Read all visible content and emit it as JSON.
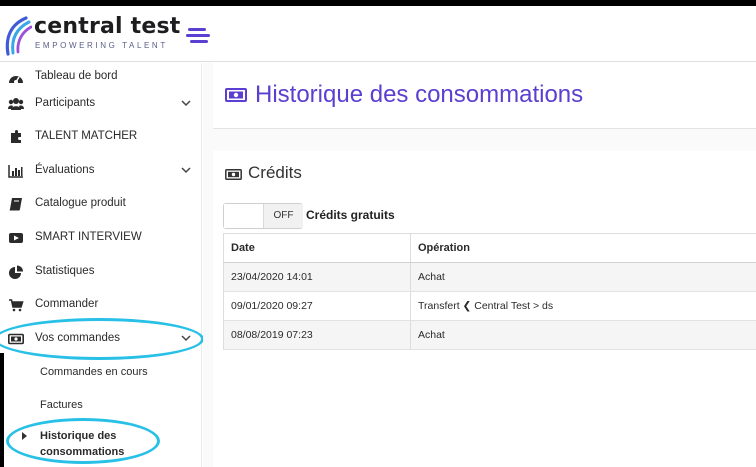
{
  "brand": {
    "name": "central test",
    "tagline": "EMPOWERING TALENT",
    "accent_color": "#5b3fd0"
  },
  "sidebar": {
    "items": [
      {
        "label": "Tableau de bord",
        "icon": "dashboard-icon"
      },
      {
        "label": "Participants",
        "icon": "users-icon",
        "expandable": true
      },
      {
        "label": "TALENT MATCHER",
        "icon": "puzzle-icon"
      },
      {
        "label": "Évaluations",
        "icon": "bar-chart-icon",
        "expandable": true
      },
      {
        "label": "Catalogue produit",
        "icon": "book-icon"
      },
      {
        "label": "SMART INTERVIEW",
        "icon": "video-icon"
      },
      {
        "label": "Statistiques",
        "icon": "pie-chart-icon"
      },
      {
        "label": "Commander",
        "icon": "cart-icon"
      },
      {
        "label": "Vos commandes",
        "icon": "money-icon",
        "expandable": true,
        "expanded": true
      }
    ],
    "sub_items": [
      {
        "label": "Commandes en cours"
      },
      {
        "label": "Factures"
      },
      {
        "label": "Historique des consommations",
        "active": true
      }
    ]
  },
  "main": {
    "page_title": "Historique des consommations",
    "section_title": "Crédits",
    "toggle": {
      "state": "OFF",
      "label": "Crédits gratuits"
    },
    "table": {
      "columns": [
        "Date",
        "Opération"
      ],
      "rows": [
        {
          "date": "23/04/2020 14:01",
          "operation": "Achat"
        },
        {
          "date": "09/01/2020 09:27",
          "operation": "Transfert ❮ Central Test > ds"
        },
        {
          "date": "08/08/2019 07:23",
          "operation": "Achat"
        }
      ]
    }
  },
  "annotation_color": "#28c0e6"
}
